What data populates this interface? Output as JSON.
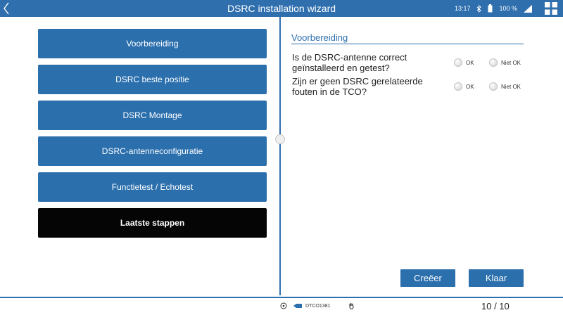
{
  "header": {
    "title": "DSRC installation wizard",
    "time": "13:17",
    "battery": "100 %",
    "bg_color": "#2f6fae"
  },
  "menu": {
    "items": [
      {
        "label": "Voorbereiding"
      },
      {
        "label": "DSRC beste positie"
      },
      {
        "label": "DSRC Montage"
      },
      {
        "label": "DSRC-antenneconfiguratie"
      },
      {
        "label": "Functietest / Echotest"
      },
      {
        "label": "Laatste stappen",
        "active": true
      }
    ],
    "button_color": "#2b6fad",
    "active_color": "#050505"
  },
  "panel": {
    "section_title": "Voorbereiding",
    "questions": [
      {
        "text": "Is de DSRC-antenne correct geïnstalleerd en getest?",
        "ok_label": "OK",
        "notok_label": "Niet OK"
      },
      {
        "text": "Zijn er geen DSRC gerelateerde fouten in de TCO?",
        "ok_label": "OK",
        "notok_label": "Niet OK"
      }
    ]
  },
  "actions": {
    "create_label": "Creëer",
    "done_label": "Klaar"
  },
  "footer": {
    "device": "DTCO1381",
    "page": "10 / 10"
  }
}
